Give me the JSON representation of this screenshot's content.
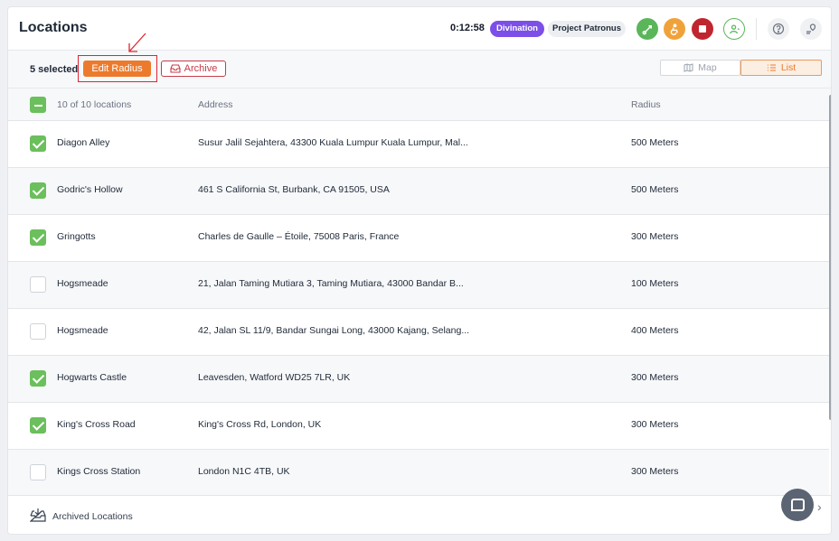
{
  "header": {
    "title": "Locations",
    "timer": "0:12:58",
    "tag_primary": "Divination",
    "tag_secondary": "Project Patronus"
  },
  "toolbar": {
    "selected": "5 selected",
    "edit_radius": "Edit Radius",
    "archive": "Archive",
    "view_map": "Map",
    "view_list": "List"
  },
  "table": {
    "count_label": "10 of 10 locations",
    "col_address": "Address",
    "col_radius": "Radius",
    "rows": [
      {
        "name": "Diagon Alley",
        "address": "Susur Jalil Sejahtera, 43300 Kuala Lumpur Kuala Lumpur, Mal...",
        "radius": "500 Meters",
        "checked": true
      },
      {
        "name": "Godric's Hollow",
        "address": "461 S California St, Burbank, CA 91505, USA",
        "radius": "500 Meters",
        "checked": true
      },
      {
        "name": "Gringotts",
        "address": "Charles de Gaulle – Étoile, 75008 Paris, France",
        "radius": "300 Meters",
        "checked": true
      },
      {
        "name": "Hogsmeade",
        "address": "21, Jalan Taming Mutiara 3, Taming Mutiara, 43000 Bandar B...",
        "radius": "100 Meters",
        "checked": false
      },
      {
        "name": "Hogsmeade",
        "address": "42, Jalan SL 11/9, Bandar Sungai Long, 43000 Kajang, Selang...",
        "radius": "400 Meters",
        "checked": false
      },
      {
        "name": "Hogwarts Castle",
        "address": "Leavesden, Watford WD25 7LR, UK",
        "radius": "300 Meters",
        "checked": true
      },
      {
        "name": "King's Cross Road",
        "address": "King's Cross Rd, London, UK",
        "radius": "300 Meters",
        "checked": true
      },
      {
        "name": "Kings Cross Station",
        "address": "London N1C 4TB, UK",
        "radius": "300 Meters",
        "checked": false
      }
    ]
  },
  "footer": {
    "archived": "Archived Locations"
  },
  "colors": {
    "accent": "#ec7a2c",
    "check": "#6bbf5c",
    "purple": "#7c4fe8",
    "danger": "#c0262f"
  }
}
